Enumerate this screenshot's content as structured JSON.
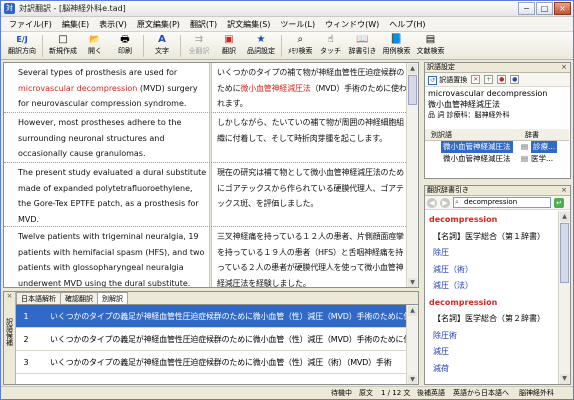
{
  "window": {
    "title": "対訳翻訳 - [脳神経外科e.tad]",
    "controls": [
      "−",
      "□",
      "×"
    ]
  },
  "menu": [
    "ファイル(F)",
    "編集(E)",
    "表示(V)",
    "原文編集(P)",
    "翻訳(T)",
    "訳文編集(S)",
    "ツール(L)",
    "ウィンドウ(W)",
    "ヘルプ(H)"
  ],
  "toolbar": {
    "buttons": [
      {
        "label": "翻訳方向",
        "icon": "E/J"
      },
      {
        "label": "新規作成",
        "icon": "□"
      },
      {
        "label": "開く",
        "icon": "📂"
      },
      {
        "label": "印刷",
        "icon": "🖶"
      },
      {
        "label": "文字",
        "icon": "A"
      },
      {
        "label": "全翻訳",
        "icon": "⇉",
        "disabled": true
      },
      {
        "label": "翻訳",
        "icon": "▣"
      },
      {
        "label": "品詞設定",
        "icon": "★"
      },
      {
        "label": "ﾒﾓﾘ検索",
        "icon": "⌕"
      },
      {
        "label": "タッチ",
        "icon": "☝"
      },
      {
        "label": "辞書引き",
        "icon": "📖"
      },
      {
        "label": "用例検索",
        "icon": "📘"
      },
      {
        "label": "文献検索",
        "icon": "▤"
      }
    ]
  },
  "segments": [
    {
      "en": [
        {
          "t": "Several types of prosthesis are used for "
        },
        {
          "t": "microvascular decompression",
          "hl": true
        },
        {
          "t": " (MVD) surgery for neurovascular compression syndrome."
        }
      ],
      "ja": [
        {
          "t": "いくつかのタイプの補て物が神経血管性圧迫症候群のために"
        },
        {
          "t": "微小血管神経減圧法",
          "hl": true
        },
        {
          "t": "（MVD）手術のために使われます。"
        }
      ]
    },
    {
      "en": [
        {
          "t": "However, most prostheses adhere to the surrounding neuronal structures and occasionally cause granulomas."
        }
      ],
      "ja": [
        {
          "t": "しかしながら、たいていの補て物が周囲の神経細胞組織に付着して、そして時折肉芽腫を起こします。"
        }
      ]
    },
    {
      "en": [
        {
          "t": "The present study evaluated a dural substitute made of expanded polytetrafluoroethylene, the Gore-Tex EPTFE patch, as a prosthesis for MVD."
        }
      ],
      "ja": [
        {
          "t": "現在の研究は補て物として微小血管神経減圧法のためにゴアテックスから作られている硬膜代理人、ゴアテックス斑、を評価しました。"
        }
      ]
    },
    {
      "en": [
        {
          "t": "Twelve patients with trigeminal neuralgia, 19 patients with hemifacial spasm (HFS), and two patients with glossopharyngeal neuralgia underwent MVD using the dural substitute."
        }
      ],
      "ja": [
        {
          "t": "三叉神経痛を持っている１２人の患者、片側顔面痙攣を持っている１９人の患者（HFS）と舌咽神経痛を持っている２人の患者が硬膜代理人を使って微小血管神経減圧法を経験しました。"
        }
      ]
    }
  ],
  "bottom": {
    "side_label": "訳語候補",
    "tabs": [
      "日本語解析",
      "確認翻訳",
      "別解訳"
    ],
    "active_tab": 2,
    "candidates": [
      {
        "num": "1",
        "text": "いくつかのタイプの義足が神経血管性圧迫症候群のために微小血管（性）減圧（MVD）手術のために使われます。",
        "selected": true
      },
      {
        "num": "2",
        "text": "いくつかのタイプの義足が神経血管性圧迫症候群のために微小血管（性）減圧（MVD）手術のために使われます。"
      },
      {
        "num": "3",
        "text": "いくつかのタイプの義足が神経血管性圧迫症候群のために微小血管（性）減圧（術）（MVD）手術"
      }
    ]
  },
  "panel1": {
    "title": "訳語設定",
    "tool_label": "訳語置換",
    "term_en": "microvascular decompression",
    "term_ja": "微小血管神経減圧法",
    "field": "品 詞  診療科：脳神経外科",
    "col_term": "別訳語",
    "col_dict": "辞書",
    "rows": [
      {
        "term": "微小血管神経減圧法",
        "dict": "診療..."
      },
      {
        "term": "微小血管神経減圧法",
        "dict": "医学..."
      }
    ]
  },
  "panel2": {
    "title": "翻訳辞書引き",
    "search_value": "decompression",
    "entries": [
      {
        "head": "decompression",
        "pos": "【名詞】医学総合（第１辞書）",
        "trans": [
          "除圧",
          "減圧（術）",
          "減圧（法）"
        ]
      },
      {
        "head": "decompression",
        "pos": "【名詞】医学総合（第２辞書）",
        "trans": [
          "除圧術",
          "減圧",
          "減荷"
        ]
      }
    ]
  },
  "status": {
    "mode": "待機中",
    "source": "原文",
    "position": "1 / 12 文",
    "mode2": "後補英語",
    "direction": "英語から日本語へ",
    "field": "脳神経外科"
  }
}
